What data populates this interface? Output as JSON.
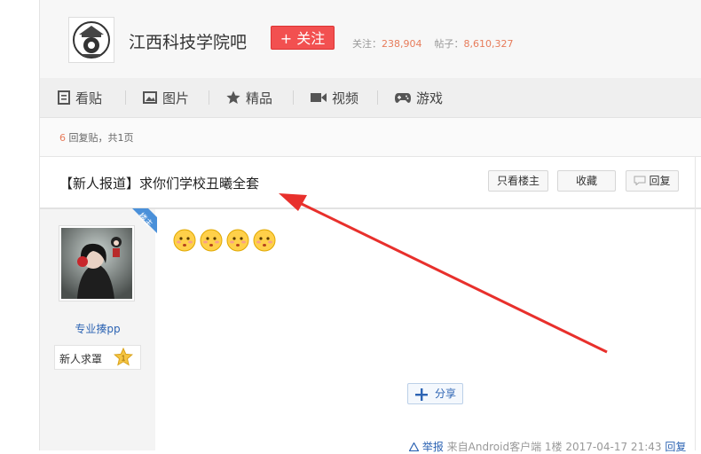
{
  "forum": {
    "name": "江西科技学院吧",
    "follow_label": "+ 关注",
    "followers_label": "关注：",
    "followers": "238,904",
    "posts_label": "帖子：",
    "posts": "8,610,327"
  },
  "nav": {
    "items": [
      {
        "label": "看贴",
        "icon": "document-icon"
      },
      {
        "label": "图片",
        "icon": "image-icon"
      },
      {
        "label": "精品",
        "icon": "star-icon"
      },
      {
        "label": "视频",
        "icon": "video-icon"
      },
      {
        "label": "游戏",
        "icon": "gamepad-icon"
      }
    ]
  },
  "thread": {
    "reply_count": "6",
    "reply_text": " 回复贴，共",
    "page_count": "1",
    "page_unit": "页",
    "title": "【新人报道】求你们学校丑曦全套",
    "only_op_label": "只看楼主",
    "favorite_label": "收藏",
    "reply_label": "回复"
  },
  "post": {
    "op_badge": "楼主",
    "author_name": "专业揍pp",
    "level_title": "新人求罩",
    "level": "1",
    "share_label": "分享",
    "report_label": "举报",
    "source": "来自Android客户端",
    "floor": "1楼",
    "datetime": "2017-04-17 21:43",
    "reply_label": "回复"
  },
  "colors": {
    "accent_red": "#f25050",
    "link_blue": "#2d64b3",
    "count_orange": "#e77c5b",
    "arrow_red": "#e8302c"
  }
}
